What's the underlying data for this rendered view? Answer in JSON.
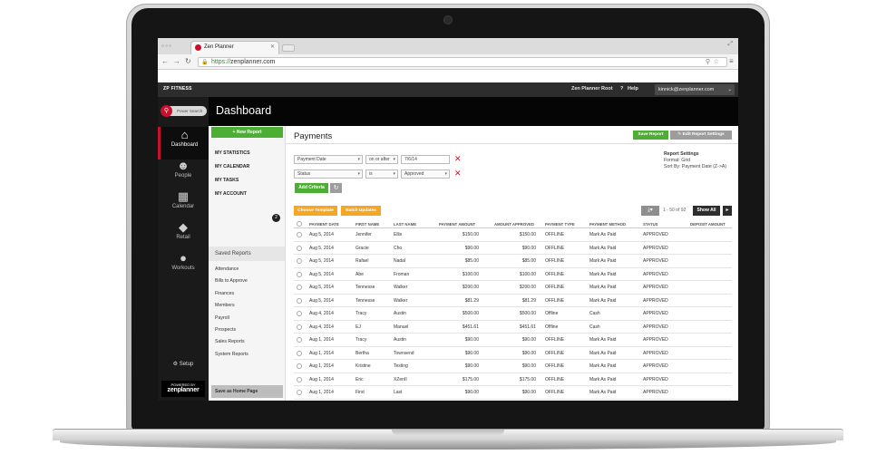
{
  "browser": {
    "tab_title": "Zen Planner",
    "url_scheme": "https://",
    "url_host": "zenplanner.com"
  },
  "app": {
    "org_name": "ZP FITNESS",
    "header_root": "Zen Planner Root",
    "header_help": "Help",
    "header_user": "kinnick@zenplanner.com",
    "search_label": "Power Search",
    "page_title": "Dashboard",
    "powered_by": "POWERED BY",
    "brand": "zenplanner"
  },
  "rail": [
    {
      "label": "Dashboard",
      "icon": "home-icon",
      "glyph": "⌂"
    },
    {
      "label": "People",
      "icon": "person-icon",
      "glyph": "☻"
    },
    {
      "label": "Calendar",
      "icon": "calendar-icon",
      "glyph": "▦"
    },
    {
      "label": "Retail",
      "icon": "tag-icon",
      "glyph": "◆"
    },
    {
      "label": "Workouts",
      "icon": "kettlebell-icon",
      "glyph": "●"
    }
  ],
  "setup_label": "Setup",
  "subnav": {
    "new_report": "+ New Report",
    "links": [
      "MY STATISTICS",
      "MY CALENDAR",
      "MY TASKS",
      "MY ACCOUNT"
    ],
    "tasks_badge": "2",
    "saved_reports_head": "Saved Reports",
    "saved_reports": [
      "Attendance",
      "Bills to Approve",
      "Finances",
      "Members",
      "Payroll",
      "Prospects",
      "Sales Reports",
      "System Reports"
    ],
    "home_page_button": "Save as Home Page"
  },
  "report": {
    "title": "Payments",
    "save_button": "Save Report",
    "edit_button": "Edit Report Settings",
    "filters": [
      {
        "field": "Payment Date",
        "op": "on or after",
        "value": "7/6/14"
      },
      {
        "field": "Status",
        "op": "is",
        "value": "Approved"
      }
    ],
    "add_criteria": "Add Criteria",
    "settings_head": "Report Settings",
    "settings_format": "Format:  Grid",
    "settings_sort": "Sort By:  Payment Date (Z->A)",
    "choose_template": "Choose Template",
    "batch_updates": "Batch Updates",
    "pagination": "1 - 50 of 92",
    "show_all": "Show All",
    "colors": {
      "green": "#4cae33",
      "orange": "#f5a623",
      "red": "#c8102e"
    }
  },
  "table": {
    "columns": [
      "PAYMENT DATE",
      "FIRST NAME",
      "LAST NAME",
      "PAYMENT AMOUNT",
      "AMOUNT APPROVED",
      "PAYMENT TYPE",
      "PAYMENT METHOD",
      "STATUS",
      "DEPOSIT AMOUNT"
    ],
    "rows": [
      [
        "Aug 5, 2014",
        "Jennifer",
        "Ellis",
        "$150.00",
        "$150.00",
        "OFFLINE",
        "Mark As Paid",
        "APPROVED"
      ],
      [
        "Aug 5, 2014",
        "Gracie",
        "Cho",
        "$90.00",
        "$90.00",
        "OFFLINE",
        "Mark As Paid",
        "APPROVED"
      ],
      [
        "Aug 5, 2014",
        "Rafael",
        "Nadal",
        "$85.00",
        "$85.00",
        "OFFLINE",
        "Mark As Paid",
        "APPROVED"
      ],
      [
        "Aug 5, 2014",
        "Abe",
        "Froman",
        "$100.00",
        "$100.00",
        "OFFLINE",
        "Mark As Paid",
        "APPROVED"
      ],
      [
        "Aug 5, 2014",
        "Tennesse",
        "Walker",
        "$200.00",
        "$200.00",
        "OFFLINE",
        "Mark As Paid",
        "APPROVED"
      ],
      [
        "Aug 5, 2014",
        "Tennesse",
        "Walker",
        "$81.29",
        "$81.29",
        "OFFLINE",
        "Mark As Paid",
        "APPROVED"
      ],
      [
        "Aug 4, 2014",
        "Tracy",
        "Austin",
        "$500.00",
        "$500.00",
        "Offline",
        "Cash",
        "APPROVED"
      ],
      [
        "Aug 4, 2014",
        "EJ",
        "Manuel",
        "$451.61",
        "$451.61",
        "Offline",
        "Cash",
        "APPROVED"
      ],
      [
        "Aug 1, 2014",
        "Tracy",
        "Austin",
        "$90.00",
        "$90.00",
        "OFFLINE",
        "Mark As Paid",
        "APPROVED"
      ],
      [
        "Aug 1, 2014",
        "Bertha",
        "Townsend",
        "$90.00",
        "$90.00",
        "OFFLINE",
        "Mark As Paid",
        "APPROVED"
      ],
      [
        "Aug 1, 2014",
        "Kristine",
        "Testing",
        "$90.00",
        "$90.00",
        "OFFLINE",
        "Mark As Paid",
        "APPROVED"
      ],
      [
        "Aug 1, 2014",
        "Eric",
        "XZenII",
        "$175.00",
        "$175.00",
        "OFFLINE",
        "Mark As Paid",
        "APPROVED"
      ],
      [
        "Aug 1, 2014",
        "First",
        "Last",
        "$90.00",
        "$90.00",
        "OFFLINE",
        "Mark As Paid",
        "APPROVED"
      ]
    ]
  }
}
